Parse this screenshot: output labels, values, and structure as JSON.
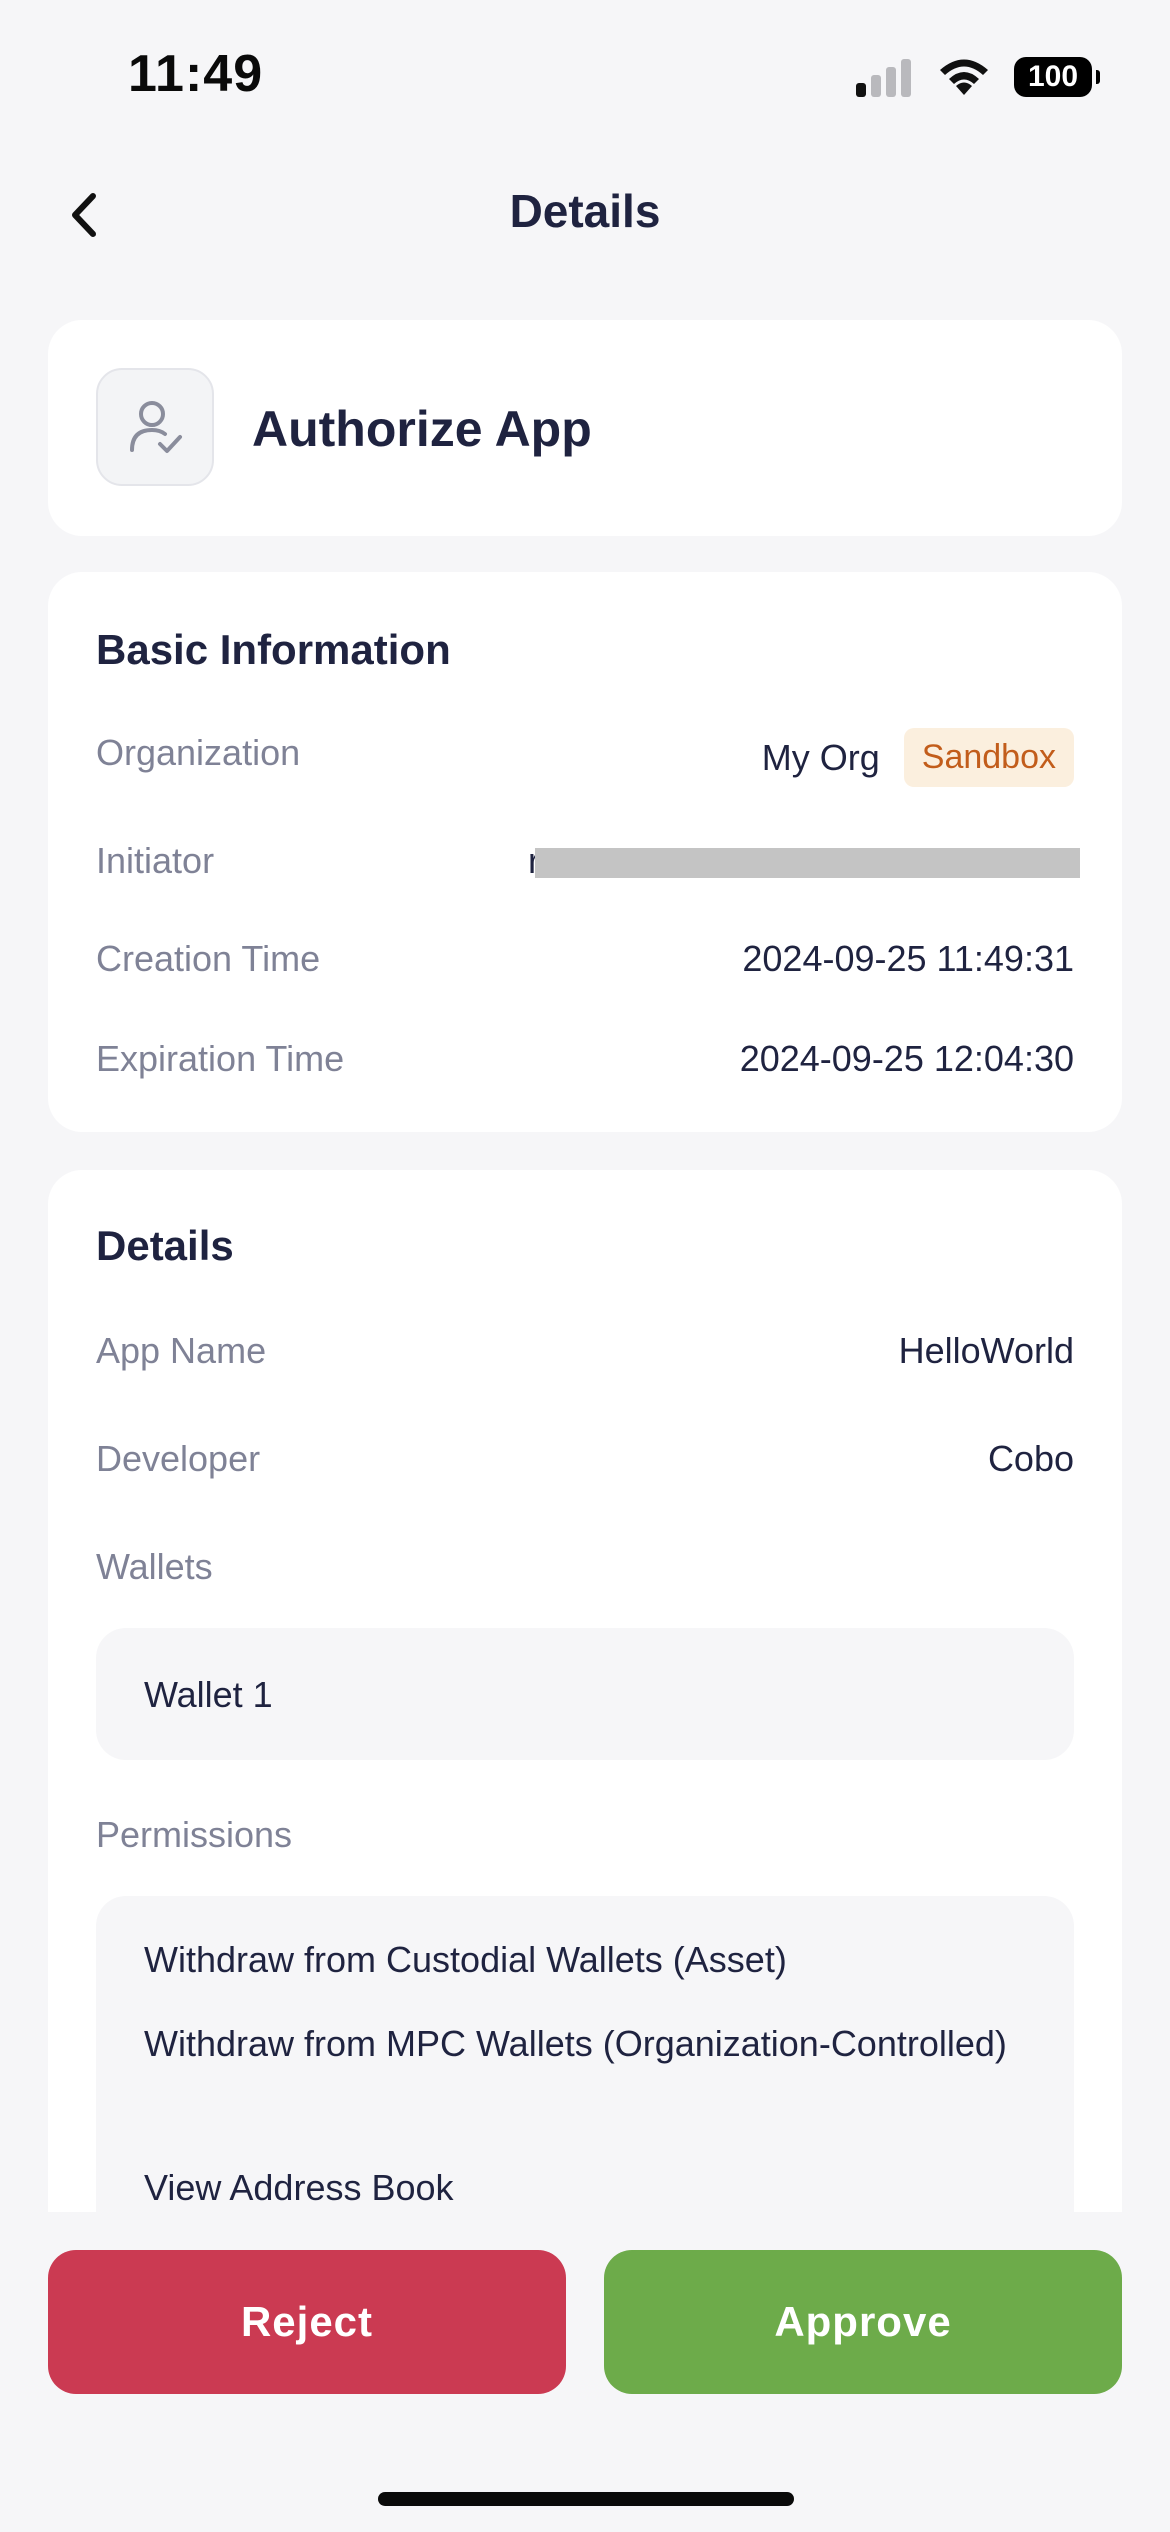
{
  "status_bar": {
    "time": "11:49",
    "battery": "100"
  },
  "nav": {
    "title": "Details"
  },
  "header_card": {
    "title": "Authorize App",
    "icon": "user-check-icon"
  },
  "basic_info": {
    "title": "Basic Information",
    "organization_label": "Organization",
    "organization_value": "My Org",
    "organization_badge": "Sandbox",
    "initiator_label": "Initiator",
    "initiator_value_prefix": "r",
    "creation_time_label": "Creation Time",
    "creation_time_value": "2024-09-25 11:49:31",
    "expiration_time_label": "Expiration Time",
    "expiration_time_value": "2024-09-25 12:04:30"
  },
  "details": {
    "title": "Details",
    "app_name_label": "App Name",
    "app_name_value": "HelloWorld",
    "developer_label": "Developer",
    "developer_value": "Cobo",
    "wallets_label": "Wallets",
    "wallets": [
      "Wallet 1"
    ],
    "permissions_label": "Permissions",
    "permissions": [
      "Withdraw from Custodial Wallets (Asset)",
      "Withdraw from MPC Wallets (Organization-Controlled)",
      "View Address Book"
    ]
  },
  "actions": {
    "reject_label": "Reject",
    "approve_label": "Approve"
  },
  "colors": {
    "reject": "#cb3a52",
    "approve": "#6dab4a",
    "badge_bg": "#fbefde",
    "badge_text": "#c25d1b"
  }
}
